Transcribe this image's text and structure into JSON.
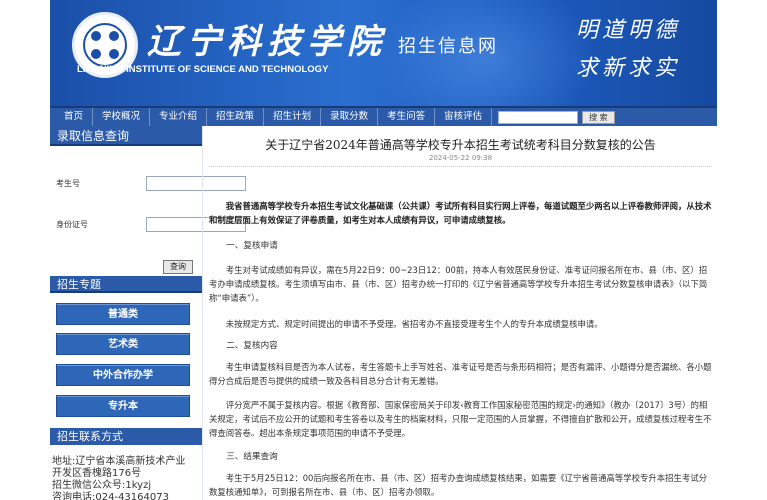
{
  "header": {
    "school_cn": "辽宁科技学院",
    "portal_title": "招生信息网",
    "school_en": "LIAONING INSTITUTE OF SCIENCE AND TECHNOLOGY",
    "motto_line1": "明道明德",
    "motto_line2": "求新求实"
  },
  "nav": {
    "items": [
      "首页",
      "学校概况",
      "专业介绍",
      "招生政策",
      "招生计划",
      "录取分数",
      "考生问答",
      "宙核评估"
    ],
    "search_button": "搜 索"
  },
  "sidebar": {
    "query_title": "录取信息查询",
    "exam_no_label": "考生号",
    "id_label": "身份证号",
    "query_button": "查询",
    "topics_title": "招生专题",
    "topics": [
      "普通类",
      "艺术类",
      "中外合作办学",
      "专升本"
    ],
    "contact_title": "招生联系方式",
    "contact_lines": [
      "地址:辽宁省本溪高新技术产业",
      "开发区香槐路176号",
      "招生微信公众号:1kyzj",
      "咨询电话:024-43164073"
    ]
  },
  "article": {
    "title": "关于辽宁省2024年普通高等学校专升本招生考试统考科目分数复核的公告",
    "date": "2024-05-22 09:38",
    "intro": "我省普通高等学校专升本招生考试文化基础课（公共课）考试所有科目实行网上评卷，每道试题至少两名以上评卷教师评阅，从技术和制度层面上有效保证了评卷质量，如考生对本人成绩有异议，可申请成绩复核。",
    "h1": "一、复核申请",
    "p1": "考生对考试成绩如有异议，需在5月22日9：00~23日12：00前，持本人有效居民身份证、准考证问报名所在市、县（市、区）招考办申请成绩复核。考生须填写由市、县（市、区）招考办统一打印的《辽宁省普通高等学校专升本招生考试分数复核申请表》（以下简称“申请表”）。",
    "p2": "未按规定方式、规定时间提出的申请不予受理。省招考办不直接受理考生个人的专升本成绩复核申请。",
    "h2": "二、复核内容",
    "p3": "考生申请复核科目是否为本人试卷，考生答题卡上手写姓名、准考证号是否与条形码相符；是否有漏评、小题得分是否漏统、各小题得分合成后是否与提供的成绩一致及各科目总分合计有无差错。",
    "p4": "评分宽严不属于复核内容。根据《教育部、国家保密局关于印发‹教育工作国家秘密范围的规定›的通知》（教办〔2017〕3号）的相关规定，考试后不应公开的试题和考生答卷以及考生的档案材料，只限一定范围的人员掌握，不得擅自扩散和公开，成绩复核过程考生不得查阅答卷。超出本条规定事项范围的申请不予受理。",
    "h3": "三、结果查询",
    "p5": "考生于5月25日12：00后向报名所在市、县（市、区）招考办查询成绩复核结果，如需要《辽宁省普通高等学校专升本招生考试分数复核通知单》，可到报名所在市、县（市、区）招考办领取。"
  }
}
